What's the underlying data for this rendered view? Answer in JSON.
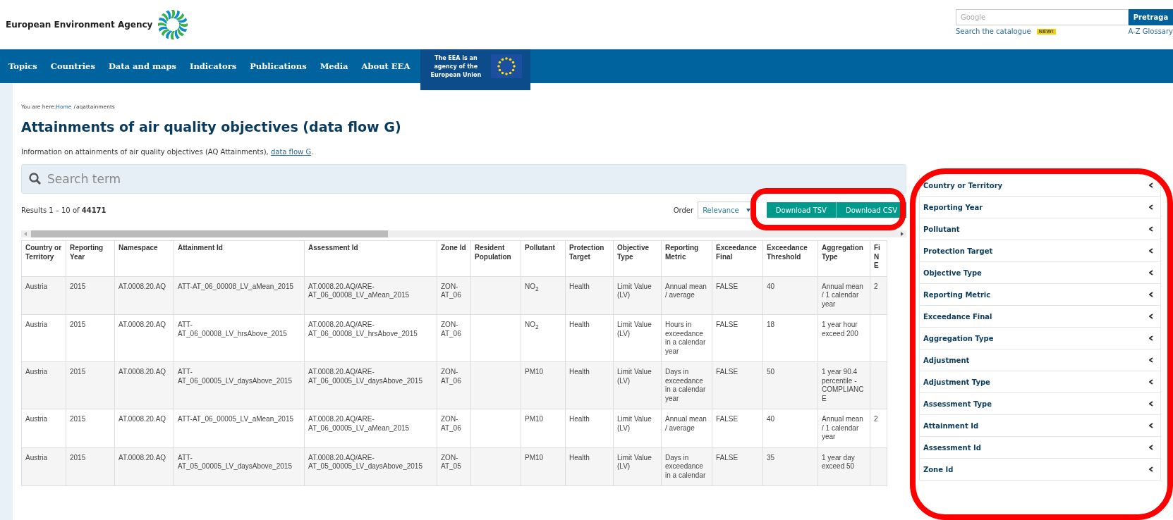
{
  "header": {
    "logo_text": "European Environment Agency",
    "search": {
      "placeholder": "Google",
      "button": "Pretraga"
    },
    "links": [
      {
        "label": "Search the catalogue",
        "badge": "NEW!"
      },
      {
        "label": "A-Z Glossary"
      }
    ]
  },
  "nav": {
    "items": [
      "Topics",
      "Countries",
      "Data and maps",
      "Indicators",
      "Publications",
      "Media",
      "About EEA"
    ],
    "eu_note": "The EEA is an agency of the European Union"
  },
  "breadcrumb": {
    "prefix": "You are here:",
    "items": [
      "Home",
      "aqattainments"
    ],
    "separator": "/"
  },
  "title": "Attainments of air quality objectives (data flow G)",
  "intro": {
    "text": "Information on attainments of air quality objectives (AQ Attainments), ",
    "link": "data flow G",
    "suffix": "."
  },
  "search": {
    "placeholder": "Search term"
  },
  "results": {
    "text": "Results 1 – 10 of ",
    "total": "44171"
  },
  "order": {
    "label": "Order",
    "value": "Relevance"
  },
  "downloads": [
    "Download TSV",
    "Download CSV"
  ],
  "table": {
    "columns": [
      "Country or Territory",
      "Reporting Year",
      "Namespace",
      "Attainment Id",
      "Assessment Id",
      "Zone Id",
      "Resident Population",
      "Pollutant",
      "Protection Target",
      "Objective Type",
      "Reporting Metric",
      "Exceedance Final",
      "Exceedance Threshold",
      "Aggregation Type",
      "Fi N E"
    ],
    "rows": [
      [
        "Austria",
        "2015",
        "AT.0008.20.AQ",
        "ATT-AT_06_00008_LV_aMean_2015",
        "AT.0008.20.AQ/ARE-AT_06_00008_LV_aMean_2015",
        "ZON-AT_06",
        "",
        "NO$_{2}$",
        "Health",
        "Limit Value (LV)",
        "Annual mean / average",
        "FALSE",
        "40",
        "Annual mean / 1 calendar year",
        "2"
      ],
      [
        "Austria",
        "2015",
        "AT.0008.20.AQ",
        "ATT-AT_06_00008_LV_hrsAbove_2015",
        "AT.0008.20.AQ/ARE-AT_06_00008_LV_hrsAbove_2015",
        "ZON-AT_06",
        "",
        "NO$_{2}$",
        "Health",
        "Limit Value (LV)",
        "Hours in exceedance in a calendar year",
        "FALSE",
        "18",
        "1 year hour exceed 200",
        ""
      ],
      [
        "Austria",
        "2015",
        "AT.0008.20.AQ",
        "ATT-AT_06_00005_LV_daysAbove_2015",
        "AT.0008.20.AQ/ARE-AT_06_00005_LV_daysAbove_2015",
        "ZON-AT_06",
        "",
        "PM10",
        "Health",
        "Limit Value (LV)",
        "Days in exceedance in a calendar year",
        "FALSE",
        "50",
        "1 year 90.4 percentile - COMPLIANCE",
        ""
      ],
      [
        "Austria",
        "2015",
        "AT.0008.20.AQ",
        "ATT-AT_06_00005_LV_aMean_2015",
        "AT.0008.20.AQ/ARE-AT_06_00005_LV_aMean_2015",
        "ZON-AT_06",
        "",
        "PM10",
        "Health",
        "Limit Value (LV)",
        "Annual mean / average",
        "FALSE",
        "40",
        "Annual mean / 1 calendar year",
        "2"
      ],
      [
        "Austria",
        "2015",
        "AT.0008.20.AQ",
        "ATT-AT_05_00005_LV_daysAbove_2015",
        "AT.0008.20.AQ/ARE-AT_05_00005_LV_daysAbove_2015",
        "ZON-AT_05",
        "",
        "PM10",
        "Health",
        "Limit Value (LV)",
        "Days in exceedance in a calendar",
        "FALSE",
        "35",
        "1 year day exceed 50",
        ""
      ]
    ]
  },
  "facets": [
    {
      "label": "Country or Territory",
      "expanded": false
    },
    {
      "label": "Reporting Year",
      "expanded": false
    },
    {
      "label": "Pollutant",
      "expanded": false
    },
    {
      "label": "Protection Target",
      "expanded": false
    },
    {
      "label": "Objective Type",
      "expanded": false
    },
    {
      "label": "Reporting Metric",
      "expanded": false
    },
    {
      "label": "Exceedance Final",
      "expanded": false
    },
    {
      "label": "Aggregation Type",
      "expanded": false
    },
    {
      "label": "Adjustment",
      "expanded": false
    },
    {
      "label": "Adjustment Type",
      "expanded": false
    },
    {
      "label": "Assessment Type",
      "expanded": false
    },
    {
      "label": "Attainment Id",
      "expanded": false
    },
    {
      "label": "Assessment Id",
      "expanded": false
    },
    {
      "label": "Zone Id",
      "expanded": false
    }
  ]
}
